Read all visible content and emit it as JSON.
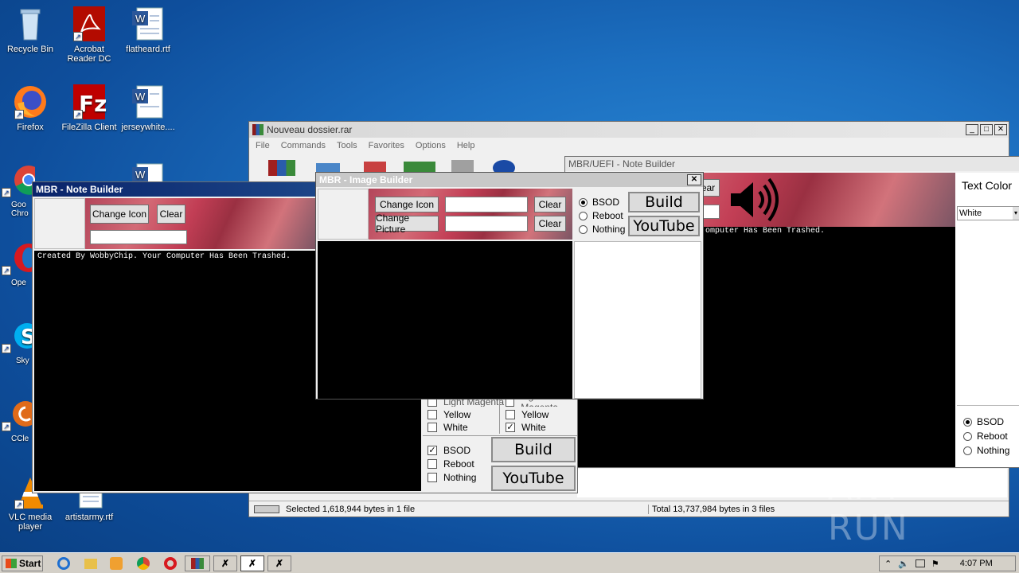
{
  "desktop": {
    "icons": [
      {
        "label": "Recycle Bin",
        "icon": "recycle-bin-icon"
      },
      {
        "label": "Acrobat Reader DC",
        "icon": "acrobat-icon"
      },
      {
        "label": "flatheard.rtf",
        "icon": "word-document-icon"
      },
      {
        "label": "Firefox",
        "icon": "firefox-icon"
      },
      {
        "label": "FileZilla Client",
        "icon": "filezilla-icon"
      },
      {
        "label": "jerseywhite....",
        "icon": "word-document-icon"
      },
      {
        "label": "Goo Chro",
        "icon": "chrome-icon"
      },
      {
        "label": "Ope",
        "icon": "opera-icon"
      },
      {
        "label": "Sky",
        "icon": "skype-icon"
      },
      {
        "label": "CCle",
        "icon": "ccleaner-icon"
      },
      {
        "label": "VLC media player",
        "icon": "vlc-icon"
      },
      {
        "label": "artistarmy.rtf",
        "icon": "document-icon"
      }
    ]
  },
  "winrar": {
    "title": "Nouveau dossier.rar",
    "menu": [
      "File",
      "Commands",
      "Tools",
      "Favorites",
      "Options",
      "Help"
    ],
    "status_left": "Selected 1,618,944 bytes in 1 file",
    "status_right": "Total 13,737,984 bytes in 3 files"
  },
  "uefi": {
    "title": "MBR/UEFI - Note Builder",
    "clear_partial": "ear",
    "text_color_label": "Text Color",
    "text_color_value": "White",
    "message": "omputer Has Been Trashed.",
    "radios": [
      {
        "label": "BSOD",
        "checked": true
      },
      {
        "label": "Reboot",
        "checked": false
      },
      {
        "label": "Nothing",
        "checked": false
      }
    ]
  },
  "note": {
    "title": "MBR - Note Builder",
    "change_icon": "Change Icon",
    "clear": "Clear",
    "message": "Created By WobbyChip. Your Computer Has Been Trashed.",
    "colors_left": [
      {
        "label": "Light Magenta",
        "checked": false
      },
      {
        "label": "Yellow",
        "checked": false
      },
      {
        "label": "White",
        "checked": false
      }
    ],
    "colors_right": [
      {
        "label": "Light Magenta",
        "checked": false
      },
      {
        "label": "Yellow",
        "checked": false
      },
      {
        "label": "White",
        "checked": true
      }
    ],
    "actions": [
      {
        "label": "BSOD",
        "checked": true
      },
      {
        "label": "Reboot",
        "checked": false
      },
      {
        "label": "Nothing",
        "checked": false
      }
    ],
    "build": "Build",
    "youtube": "YouTube"
  },
  "image": {
    "title": "MBR - Image Builder",
    "close": "✕",
    "change_icon": "Change Icon",
    "change_picture": "Change Picture",
    "clear1": "Clear",
    "clear2": "Clear",
    "radios": [
      {
        "label": "BSOD",
        "checked": true
      },
      {
        "label": "Reboot",
        "checked": false
      },
      {
        "label": "Nothing",
        "checked": false
      }
    ],
    "build": "Build",
    "youtube": "YouTube"
  },
  "taskbar": {
    "start": "Start",
    "clock": "4:07 PM"
  },
  "watermark": "ANY RUN"
}
